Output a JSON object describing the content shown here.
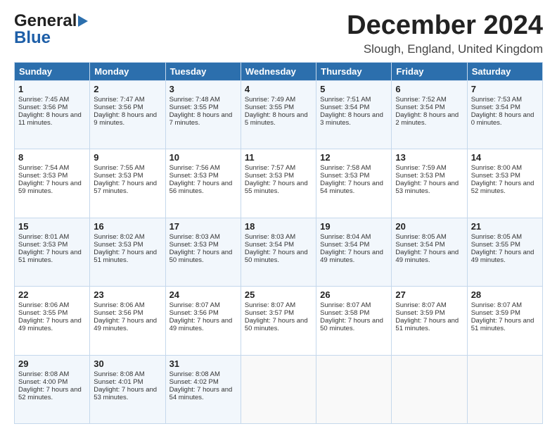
{
  "header": {
    "logo_line1": "General",
    "logo_line2": "Blue",
    "month_title": "December 2024",
    "location": "Slough, England, United Kingdom"
  },
  "days_of_week": [
    "Sunday",
    "Monday",
    "Tuesday",
    "Wednesday",
    "Thursday",
    "Friday",
    "Saturday"
  ],
  "weeks": [
    [
      {
        "day": "1",
        "sunrise": "Sunrise: 7:45 AM",
        "sunset": "Sunset: 3:56 PM",
        "daylight": "Daylight: 8 hours and 11 minutes."
      },
      {
        "day": "2",
        "sunrise": "Sunrise: 7:47 AM",
        "sunset": "Sunset: 3:56 PM",
        "daylight": "Daylight: 8 hours and 9 minutes."
      },
      {
        "day": "3",
        "sunrise": "Sunrise: 7:48 AM",
        "sunset": "Sunset: 3:55 PM",
        "daylight": "Daylight: 8 hours and 7 minutes."
      },
      {
        "day": "4",
        "sunrise": "Sunrise: 7:49 AM",
        "sunset": "Sunset: 3:55 PM",
        "daylight": "Daylight: 8 hours and 5 minutes."
      },
      {
        "day": "5",
        "sunrise": "Sunrise: 7:51 AM",
        "sunset": "Sunset: 3:54 PM",
        "daylight": "Daylight: 8 hours and 3 minutes."
      },
      {
        "day": "6",
        "sunrise": "Sunrise: 7:52 AM",
        "sunset": "Sunset: 3:54 PM",
        "daylight": "Daylight: 8 hours and 2 minutes."
      },
      {
        "day": "7",
        "sunrise": "Sunrise: 7:53 AM",
        "sunset": "Sunset: 3:54 PM",
        "daylight": "Daylight: 8 hours and 0 minutes."
      }
    ],
    [
      {
        "day": "8",
        "sunrise": "Sunrise: 7:54 AM",
        "sunset": "Sunset: 3:53 PM",
        "daylight": "Daylight: 7 hours and 59 minutes."
      },
      {
        "day": "9",
        "sunrise": "Sunrise: 7:55 AM",
        "sunset": "Sunset: 3:53 PM",
        "daylight": "Daylight: 7 hours and 57 minutes."
      },
      {
        "day": "10",
        "sunrise": "Sunrise: 7:56 AM",
        "sunset": "Sunset: 3:53 PM",
        "daylight": "Daylight: 7 hours and 56 minutes."
      },
      {
        "day": "11",
        "sunrise": "Sunrise: 7:57 AM",
        "sunset": "Sunset: 3:53 PM",
        "daylight": "Daylight: 7 hours and 55 minutes."
      },
      {
        "day": "12",
        "sunrise": "Sunrise: 7:58 AM",
        "sunset": "Sunset: 3:53 PM",
        "daylight": "Daylight: 7 hours and 54 minutes."
      },
      {
        "day": "13",
        "sunrise": "Sunrise: 7:59 AM",
        "sunset": "Sunset: 3:53 PM",
        "daylight": "Daylight: 7 hours and 53 minutes."
      },
      {
        "day": "14",
        "sunrise": "Sunrise: 8:00 AM",
        "sunset": "Sunset: 3:53 PM",
        "daylight": "Daylight: 7 hours and 52 minutes."
      }
    ],
    [
      {
        "day": "15",
        "sunrise": "Sunrise: 8:01 AM",
        "sunset": "Sunset: 3:53 PM",
        "daylight": "Daylight: 7 hours and 51 minutes."
      },
      {
        "day": "16",
        "sunrise": "Sunrise: 8:02 AM",
        "sunset": "Sunset: 3:53 PM",
        "daylight": "Daylight: 7 hours and 51 minutes."
      },
      {
        "day": "17",
        "sunrise": "Sunrise: 8:03 AM",
        "sunset": "Sunset: 3:53 PM",
        "daylight": "Daylight: 7 hours and 50 minutes."
      },
      {
        "day": "18",
        "sunrise": "Sunrise: 8:03 AM",
        "sunset": "Sunset: 3:54 PM",
        "daylight": "Daylight: 7 hours and 50 minutes."
      },
      {
        "day": "19",
        "sunrise": "Sunrise: 8:04 AM",
        "sunset": "Sunset: 3:54 PM",
        "daylight": "Daylight: 7 hours and 49 minutes."
      },
      {
        "day": "20",
        "sunrise": "Sunrise: 8:05 AM",
        "sunset": "Sunset: 3:54 PM",
        "daylight": "Daylight: 7 hours and 49 minutes."
      },
      {
        "day": "21",
        "sunrise": "Sunrise: 8:05 AM",
        "sunset": "Sunset: 3:55 PM",
        "daylight": "Daylight: 7 hours and 49 minutes."
      }
    ],
    [
      {
        "day": "22",
        "sunrise": "Sunrise: 8:06 AM",
        "sunset": "Sunset: 3:55 PM",
        "daylight": "Daylight: 7 hours and 49 minutes."
      },
      {
        "day": "23",
        "sunrise": "Sunrise: 8:06 AM",
        "sunset": "Sunset: 3:56 PM",
        "daylight": "Daylight: 7 hours and 49 minutes."
      },
      {
        "day": "24",
        "sunrise": "Sunrise: 8:07 AM",
        "sunset": "Sunset: 3:56 PM",
        "daylight": "Daylight: 7 hours and 49 minutes."
      },
      {
        "day": "25",
        "sunrise": "Sunrise: 8:07 AM",
        "sunset": "Sunset: 3:57 PM",
        "daylight": "Daylight: 7 hours and 50 minutes."
      },
      {
        "day": "26",
        "sunrise": "Sunrise: 8:07 AM",
        "sunset": "Sunset: 3:58 PM",
        "daylight": "Daylight: 7 hours and 50 minutes."
      },
      {
        "day": "27",
        "sunrise": "Sunrise: 8:07 AM",
        "sunset": "Sunset: 3:59 PM",
        "daylight": "Daylight: 7 hours and 51 minutes."
      },
      {
        "day": "28",
        "sunrise": "Sunrise: 8:07 AM",
        "sunset": "Sunset: 3:59 PM",
        "daylight": "Daylight: 7 hours and 51 minutes."
      }
    ],
    [
      {
        "day": "29",
        "sunrise": "Sunrise: 8:08 AM",
        "sunset": "Sunset: 4:00 PM",
        "daylight": "Daylight: 7 hours and 52 minutes."
      },
      {
        "day": "30",
        "sunrise": "Sunrise: 8:08 AM",
        "sunset": "Sunset: 4:01 PM",
        "daylight": "Daylight: 7 hours and 53 minutes."
      },
      {
        "day": "31",
        "sunrise": "Sunrise: 8:08 AM",
        "sunset": "Sunset: 4:02 PM",
        "daylight": "Daylight: 7 hours and 54 minutes."
      },
      null,
      null,
      null,
      null
    ]
  ]
}
